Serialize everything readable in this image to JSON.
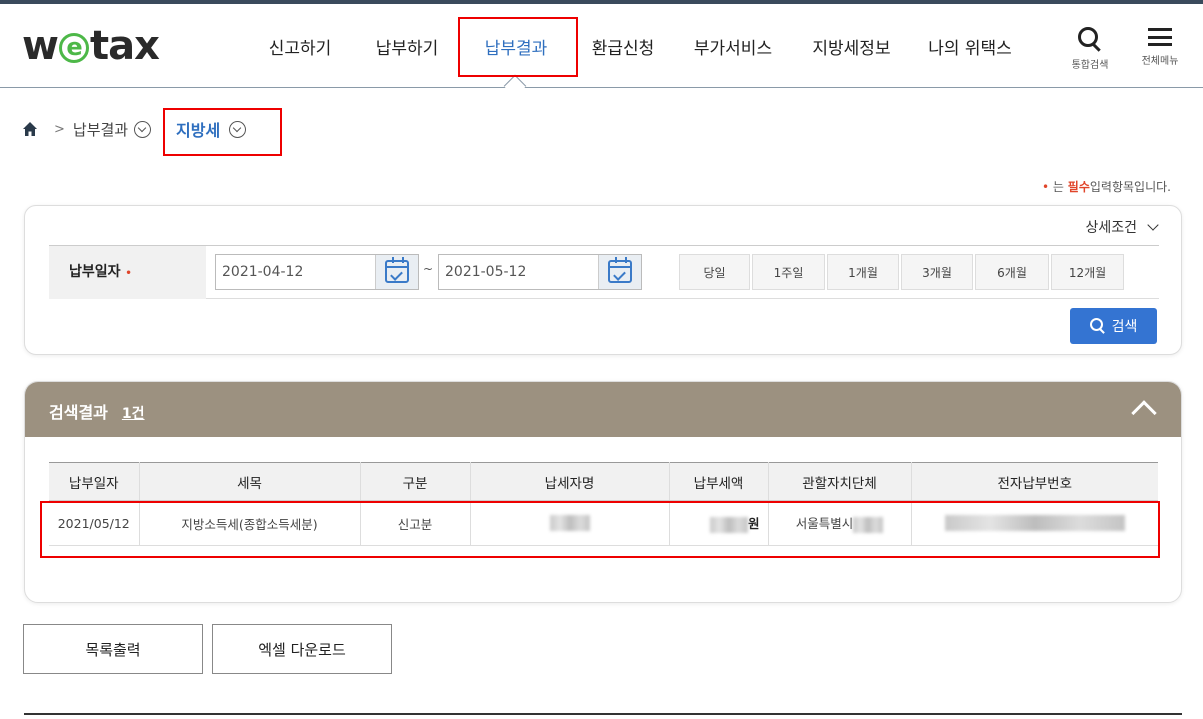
{
  "header": {
    "logo": {
      "w": "w",
      "e": "e",
      "rest": "tax"
    },
    "nav": [
      {
        "label": "신고하기",
        "active": false
      },
      {
        "label": "납부하기",
        "active": false
      },
      {
        "label": "납부결과",
        "active": true
      },
      {
        "label": "환급신청",
        "active": false
      },
      {
        "label": "부가서비스",
        "active": false
      },
      {
        "label": "지방세정보",
        "active": false
      },
      {
        "label": "나의 위택스",
        "active": false
      }
    ],
    "search_label": "통합검색",
    "menu_label": "전체메뉴"
  },
  "breadcrumb": {
    "parent": "납부결과",
    "current": "지방세"
  },
  "required_note": {
    "dot": "•",
    "before": "는",
    "highlight": "필수",
    "after": "입력항목입니다."
  },
  "search_panel": {
    "detail_toggle": "상세조건",
    "date_label": "납부일자",
    "required_mark": "•",
    "start_date": "2021-04-12",
    "end_date": "2021-05-12",
    "tilde": "~",
    "periods": [
      "당일",
      "1주일",
      "1개월",
      "3개월",
      "6개월",
      "12개월"
    ],
    "search_button": "검색"
  },
  "results": {
    "title": "검색결과",
    "count": "1건",
    "columns": [
      "납부일자",
      "세목",
      "구분",
      "납세자명",
      "납부세액",
      "관할자치단체",
      "전자납부번호"
    ],
    "rows": [
      {
        "date": "2021/05/12",
        "tax_item": "지방소득세(종합소득세분)",
        "type": "신고분",
        "amount_unit": "원",
        "authority": "서울특별시"
      }
    ]
  },
  "buttons": {
    "print": "목록출력",
    "excel": "엑셀 다운로드"
  },
  "colors": {
    "accent_blue": "#2f6fbf",
    "search_button": "#3474d2",
    "results_header": "#9c9180",
    "highlight_box": "#ee0000",
    "logo_green": "#4db848"
  }
}
